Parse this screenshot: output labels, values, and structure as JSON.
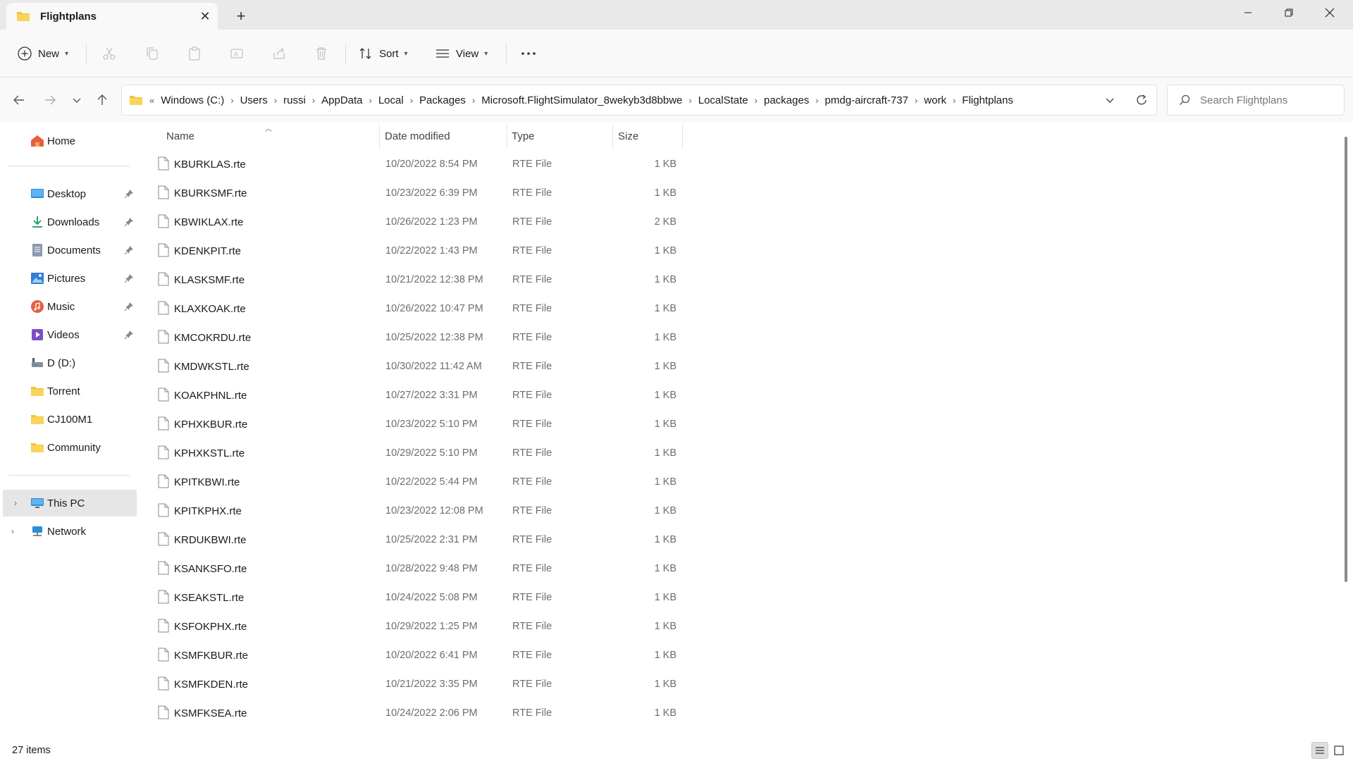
{
  "window": {
    "tab_title": "Flightplans",
    "new_tab_glyph": "+",
    "tab_close_glyph": "✕"
  },
  "toolbar": {
    "new_label": "New",
    "sort_label": "Sort",
    "view_label": "View",
    "more_label": "···",
    "icons": [
      "plus-circle-icon",
      "cut-icon",
      "copy-icon",
      "paste-icon",
      "rename-icon",
      "share-icon",
      "delete-icon",
      "sort-icon",
      "view-icon",
      "more-icon"
    ]
  },
  "address": {
    "overflow_glyph": "«",
    "crumbs": [
      "Windows (C:)",
      "Users",
      "russi",
      "AppData",
      "Local",
      "Packages",
      "Microsoft.FlightSimulator_8wekyb3d8bbwe",
      "LocalState",
      "packages",
      "pmdg-aircraft-737",
      "work",
      "Flightplans"
    ],
    "search_placeholder": "Search Flightplans"
  },
  "sidebar": {
    "home": "Home",
    "quick_access": [
      {
        "label": "Desktop",
        "icon": "desktop-icon",
        "color": "#2b8ed8"
      },
      {
        "label": "Downloads",
        "icon": "download-icon",
        "color": "#1b9a59"
      },
      {
        "label": "Documents",
        "icon": "document-icon",
        "color": "#7a8a9c"
      },
      {
        "label": "Pictures",
        "icon": "pictures-icon",
        "color": "#2f7fd6"
      },
      {
        "label": "Music",
        "icon": "music-icon",
        "color": "#e5603f"
      },
      {
        "label": "Videos",
        "icon": "videos-icon",
        "color": "#7b4fc9"
      }
    ],
    "drives": [
      {
        "label": "D (D:)",
        "icon": "drive-icon"
      },
      {
        "label": "Torrent",
        "icon": "folder-icon"
      },
      {
        "label": "CJ100M1",
        "icon": "folder-icon"
      },
      {
        "label": "Community",
        "icon": "folder-icon"
      }
    ],
    "this_pc": "This PC",
    "network": "Network"
  },
  "columns": {
    "name": "Name",
    "date": "Date modified",
    "type": "Type",
    "size": "Size"
  },
  "files": [
    {
      "name": "KBURKLAS.rte",
      "date": "10/20/2022 8:54 PM",
      "type": "RTE File",
      "size": "1 KB"
    },
    {
      "name": "KBURKSMF.rte",
      "date": "10/23/2022 6:39 PM",
      "type": "RTE File",
      "size": "1 KB"
    },
    {
      "name": "KBWIKLAX.rte",
      "date": "10/26/2022 1:23 PM",
      "type": "RTE File",
      "size": "2 KB"
    },
    {
      "name": "KDENKPIT.rte",
      "date": "10/22/2022 1:43 PM",
      "type": "RTE File",
      "size": "1 KB"
    },
    {
      "name": "KLASKSMF.rte",
      "date": "10/21/2022 12:38 PM",
      "type": "RTE File",
      "size": "1 KB"
    },
    {
      "name": "KLAXKOAK.rte",
      "date": "10/26/2022 10:47 PM",
      "type": "RTE File",
      "size": "1 KB"
    },
    {
      "name": "KMCOKRDU.rte",
      "date": "10/25/2022 12:38 PM",
      "type": "RTE File",
      "size": "1 KB"
    },
    {
      "name": "KMDWKSTL.rte",
      "date": "10/30/2022 11:42 AM",
      "type": "RTE File",
      "size": "1 KB"
    },
    {
      "name": "KOAKPHNL.rte",
      "date": "10/27/2022 3:31 PM",
      "type": "RTE File",
      "size": "1 KB"
    },
    {
      "name": "KPHXKBUR.rte",
      "date": "10/23/2022 5:10 PM",
      "type": "RTE File",
      "size": "1 KB"
    },
    {
      "name": "KPHXKSTL.rte",
      "date": "10/29/2022 5:10 PM",
      "type": "RTE File",
      "size": "1 KB"
    },
    {
      "name": "KPITKBWI.rte",
      "date": "10/22/2022 5:44 PM",
      "type": "RTE File",
      "size": "1 KB"
    },
    {
      "name": "KPITKPHX.rte",
      "date": "10/23/2022 12:08 PM",
      "type": "RTE File",
      "size": "1 KB"
    },
    {
      "name": "KRDUKBWI.rte",
      "date": "10/25/2022 2:31 PM",
      "type": "RTE File",
      "size": "1 KB"
    },
    {
      "name": "KSANKSFO.rte",
      "date": "10/28/2022 9:48 PM",
      "type": "RTE File",
      "size": "1 KB"
    },
    {
      "name": "KSEAKSTL.rte",
      "date": "10/24/2022 5:08 PM",
      "type": "RTE File",
      "size": "1 KB"
    },
    {
      "name": "KSFOKPHX.rte",
      "date": "10/29/2022 1:25 PM",
      "type": "RTE File",
      "size": "1 KB"
    },
    {
      "name": "KSMFKBUR.rte",
      "date": "10/20/2022 6:41 PM",
      "type": "RTE File",
      "size": "1 KB"
    },
    {
      "name": "KSMFKDEN.rte",
      "date": "10/21/2022 3:35 PM",
      "type": "RTE File",
      "size": "1 KB"
    },
    {
      "name": "KSMFKSEA.rte",
      "date": "10/24/2022 2:06 PM",
      "type": "RTE File",
      "size": "1 KB"
    }
  ],
  "status": {
    "item_count": "27 items"
  },
  "colors": {
    "folder": "#f2c237",
    "accent": "#0067c0"
  }
}
